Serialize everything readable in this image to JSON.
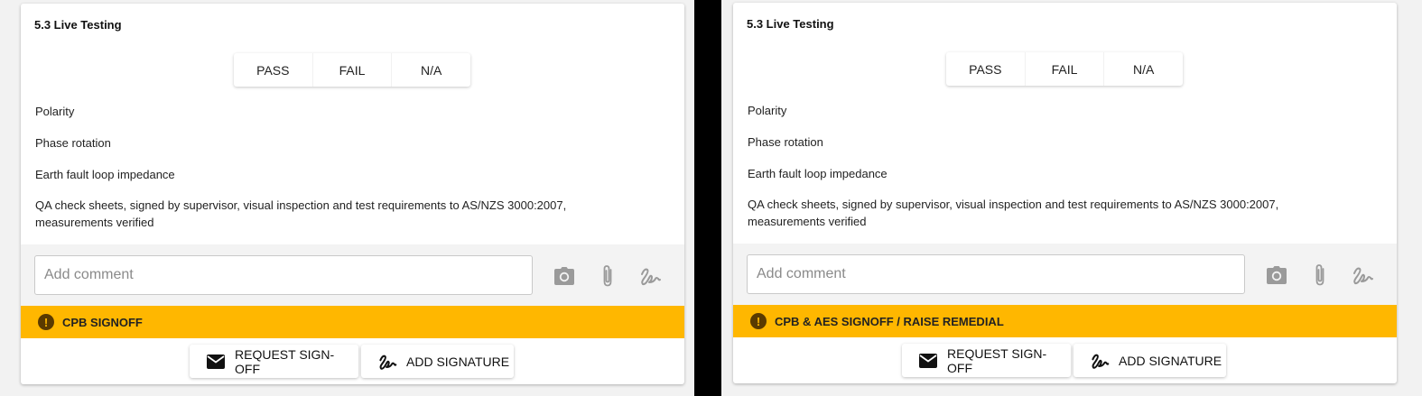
{
  "panels": [
    {
      "title": "5.3 Live Testing",
      "options": [
        "PASS",
        "FAIL",
        "N/A"
      ],
      "checks": [
        "Polarity",
        "Phase rotation",
        "Earth fault loop impedance",
        "QA check sheets, signed by supervisor, visual inspection and test requirements to AS/NZS 3000:2007, measurements verified"
      ],
      "comment": {
        "placeholder": "Add comment",
        "value": ""
      },
      "tools": [
        "camera-icon",
        "paperclip-icon",
        "signature-icon"
      ],
      "banner": {
        "icon": "alert-circle-icon",
        "text": "CPB SIGNOFF",
        "color": "#ffb700"
      },
      "actions": {
        "request": "REQUEST SIGN-OFF",
        "sign": "ADD SIGNATURE"
      }
    },
    {
      "title": "5.3 Live Testing",
      "options": [
        "PASS",
        "FAIL",
        "N/A"
      ],
      "checks": [
        "Polarity",
        "Phase rotation",
        "Earth fault loop impedance",
        "QA check sheets, signed by supervisor, visual inspection and test requirements to AS/NZS 3000:2007, measurements verified"
      ],
      "comment": {
        "placeholder": "Add comment",
        "value": ""
      },
      "tools": [
        "camera-icon",
        "paperclip-icon",
        "signature-icon"
      ],
      "banner": {
        "icon": "alert-circle-icon",
        "text": "CPB & AES SIGNOFF / RAISE REMEDIAL",
        "color": "#ffb700"
      },
      "actions": {
        "request": "REQUEST SIGN-OFF",
        "sign": "ADD SIGNATURE"
      }
    }
  ]
}
